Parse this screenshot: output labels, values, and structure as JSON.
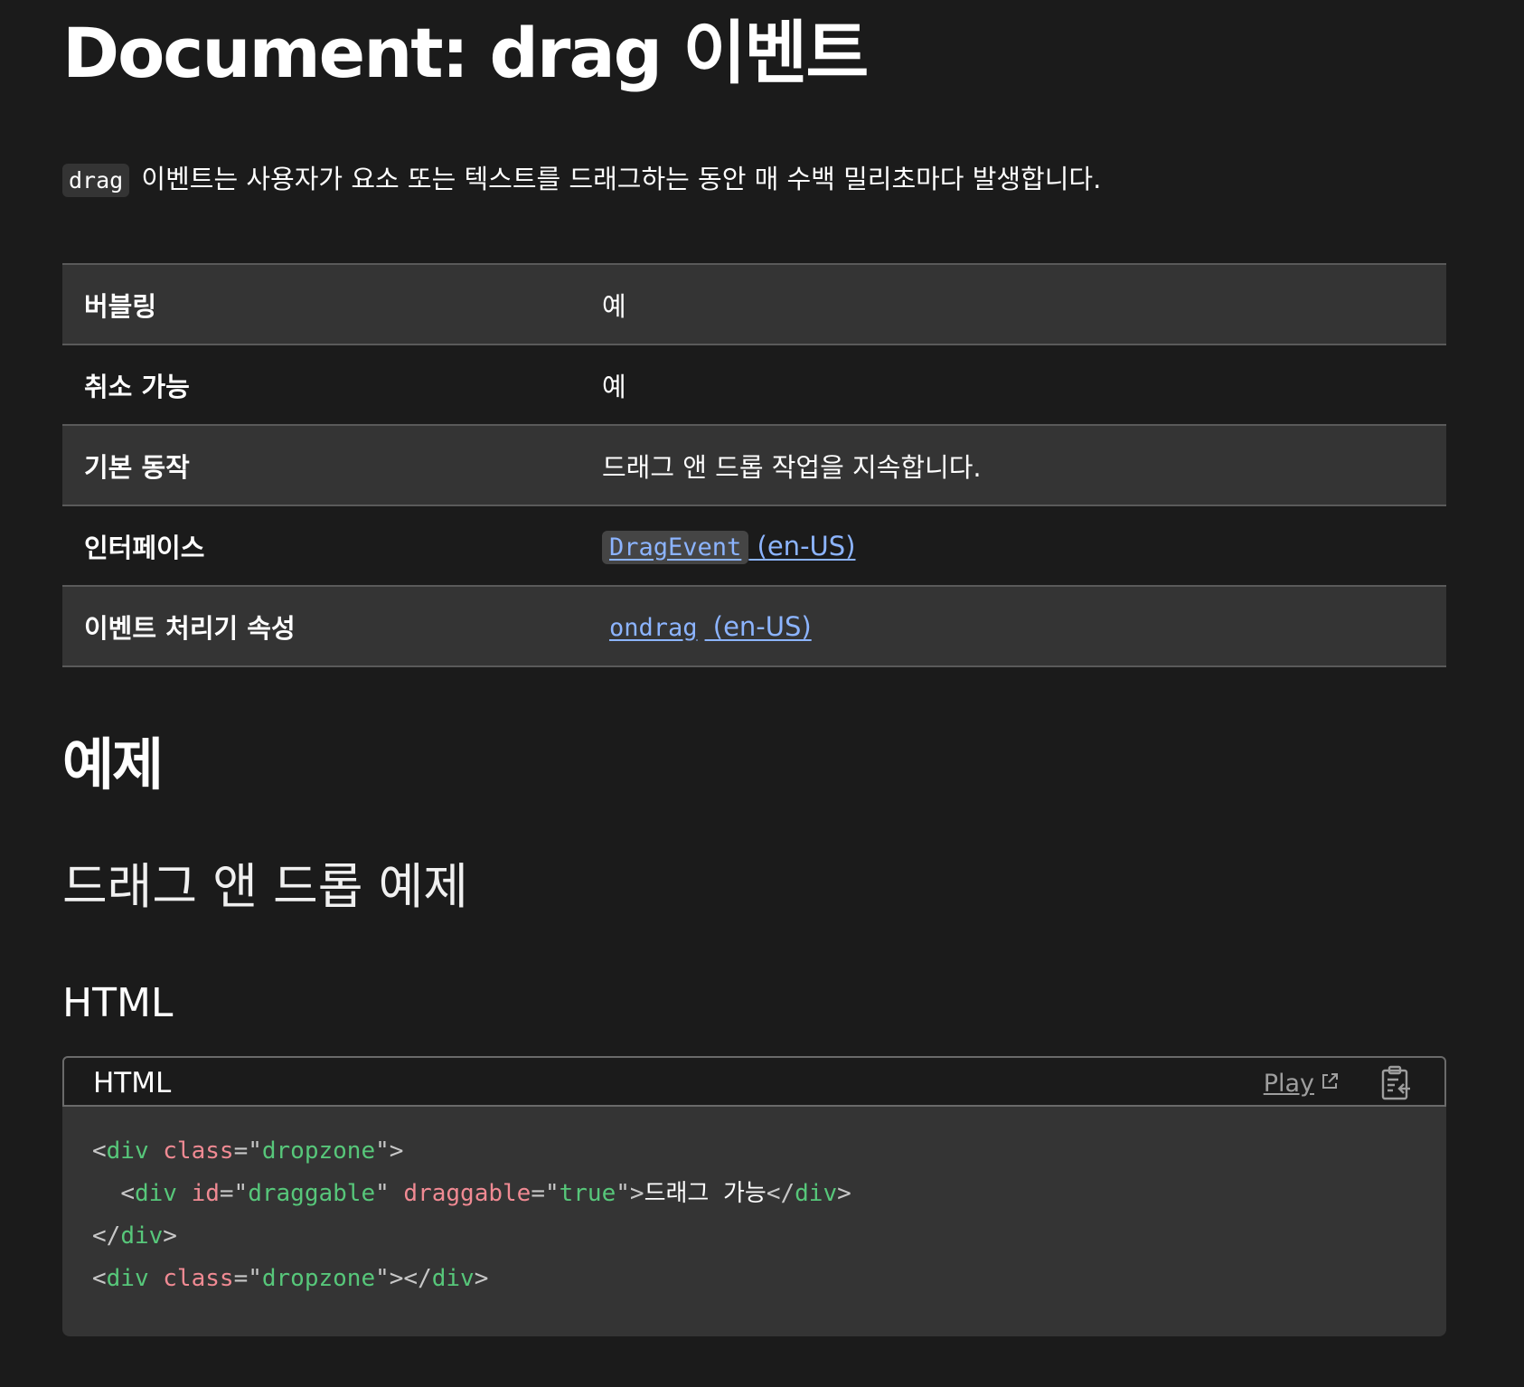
{
  "title": "Document: drag 이벤트",
  "intro": {
    "code": "drag",
    "text": " 이벤트는 사용자가 요소 또는 텍스트를 드래그하는 동안 매 수백 밀리초마다 발생합니다."
  },
  "properties": [
    {
      "label": "버블링",
      "value": "예"
    },
    {
      "label": "취소 가능",
      "value": "예"
    },
    {
      "label": "기본 동작",
      "value": "드래그 앤 드롭 작업을 지속합니다."
    },
    {
      "label": "인터페이스",
      "link_code": "DragEvent",
      "link_suffix": " (en-US)"
    },
    {
      "label": "이벤트 처리기 속성",
      "link_code": "ondrag",
      "link_suffix": " (en-US)"
    }
  ],
  "section_heading": "예제",
  "subsection_heading": "드래그 앤 드롭 예제",
  "html_heading": "HTML",
  "code_block": {
    "language": "HTML",
    "play_label": "Play",
    "lines": [
      {
        "tokens": [
          {
            "t": "punc",
            "v": "<"
          },
          {
            "t": "tag",
            "v": "div"
          },
          {
            "t": "text",
            "v": " "
          },
          {
            "t": "attr",
            "v": "class"
          },
          {
            "t": "punc",
            "v": "=\""
          },
          {
            "t": "str",
            "v": "dropzone"
          },
          {
            "t": "punc",
            "v": "\">"
          }
        ]
      },
      {
        "tokens": [
          {
            "t": "text",
            "v": "  "
          },
          {
            "t": "punc",
            "v": "<"
          },
          {
            "t": "tag",
            "v": "div"
          },
          {
            "t": "text",
            "v": " "
          },
          {
            "t": "attr",
            "v": "id"
          },
          {
            "t": "punc",
            "v": "=\""
          },
          {
            "t": "str",
            "v": "draggable"
          },
          {
            "t": "punc",
            "v": "\""
          },
          {
            "t": "text",
            "v": " "
          },
          {
            "t": "attr",
            "v": "draggable"
          },
          {
            "t": "punc",
            "v": "=\""
          },
          {
            "t": "str",
            "v": "true"
          },
          {
            "t": "punc",
            "v": "\">"
          },
          {
            "t": "text",
            "v": "드래그 가능"
          },
          {
            "t": "punc",
            "v": "</"
          },
          {
            "t": "tag",
            "v": "div"
          },
          {
            "t": "punc",
            "v": ">"
          }
        ]
      },
      {
        "tokens": [
          {
            "t": "punc",
            "v": "</"
          },
          {
            "t": "tag",
            "v": "div"
          },
          {
            "t": "punc",
            "v": ">"
          }
        ]
      },
      {
        "tokens": [
          {
            "t": "punc",
            "v": "<"
          },
          {
            "t": "tag",
            "v": "div"
          },
          {
            "t": "text",
            "v": " "
          },
          {
            "t": "attr",
            "v": "class"
          },
          {
            "t": "punc",
            "v": "=\""
          },
          {
            "t": "str",
            "v": "dropzone"
          },
          {
            "t": "punc",
            "v": "\"></"
          },
          {
            "t": "tag",
            "v": "div"
          },
          {
            "t": "punc",
            "v": ">"
          }
        ]
      }
    ]
  },
  "icons": {
    "external_link": "external-link-icon",
    "copy": "clipboard-copy-icon"
  },
  "colors": {
    "background": "#1b1b1b",
    "row_alt": "#343434",
    "link": "#8cb4ff",
    "tag": "#57c77a",
    "attr": "#f08a93"
  }
}
